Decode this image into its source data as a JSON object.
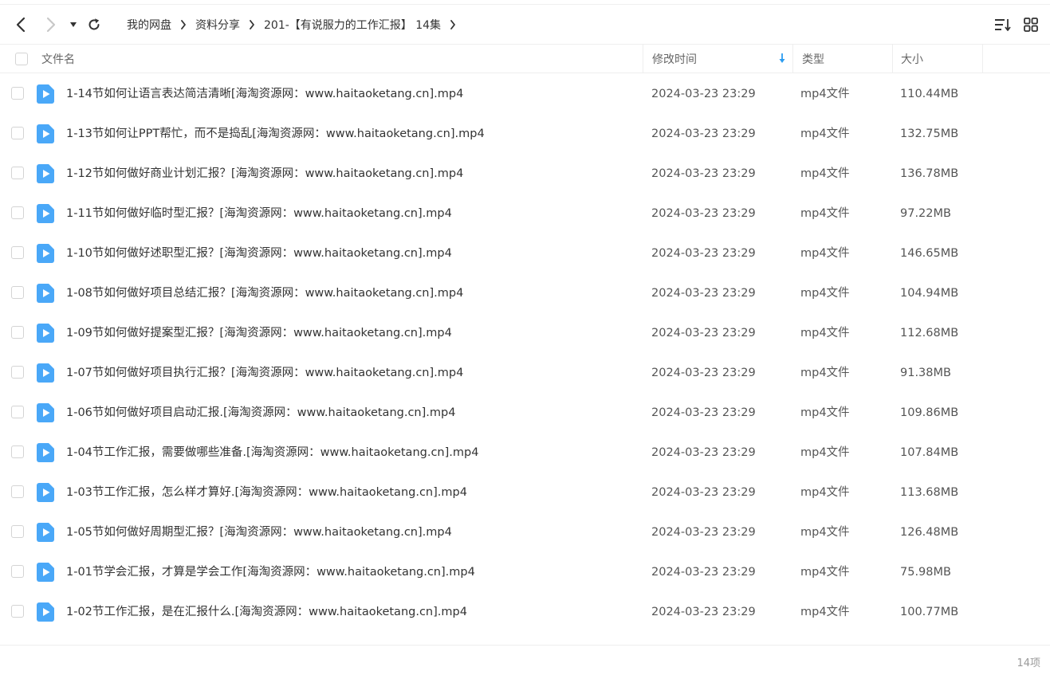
{
  "breadcrumb": [
    {
      "label": "我的网盘"
    },
    {
      "label": "资料分享"
    },
    {
      "label": "201-【有说服力的工作汇报】 14集"
    }
  ],
  "columns": {
    "name": "文件名",
    "time": "修改时间",
    "type": "类型",
    "size": "大小"
  },
  "files": [
    {
      "name": "1-14节如何让语言表达简洁清晰[海淘资源网：www.haitaoketang.cn].mp4",
      "time": "2024-03-23 23:29",
      "type": "mp4文件",
      "size": "110.44MB"
    },
    {
      "name": "1-13节如何让PPT帮忙，而不是捣乱[海淘资源网：www.haitaoketang.cn].mp4",
      "time": "2024-03-23 23:29",
      "type": "mp4文件",
      "size": "132.75MB"
    },
    {
      "name": "1-12节如何做好商业计划汇报？[海淘资源网：www.haitaoketang.cn].mp4",
      "time": "2024-03-23 23:29",
      "type": "mp4文件",
      "size": "136.78MB"
    },
    {
      "name": "1-11节如何做好临时型汇报？[海淘资源网：www.haitaoketang.cn].mp4",
      "time": "2024-03-23 23:29",
      "type": "mp4文件",
      "size": "97.22MB"
    },
    {
      "name": "1-10节如何做好述职型汇报？[海淘资源网：www.haitaoketang.cn].mp4",
      "time": "2024-03-23 23:29",
      "type": "mp4文件",
      "size": "146.65MB"
    },
    {
      "name": "1-08节如何做好项目总结汇报？[海淘资源网：www.haitaoketang.cn].mp4",
      "time": "2024-03-23 23:29",
      "type": "mp4文件",
      "size": "104.94MB"
    },
    {
      "name": "1-09节如何做好提案型汇报？[海淘资源网：www.haitaoketang.cn].mp4",
      "time": "2024-03-23 23:29",
      "type": "mp4文件",
      "size": "112.68MB"
    },
    {
      "name": "1-07节如何做好项目执行汇报？[海淘资源网：www.haitaoketang.cn].mp4",
      "time": "2024-03-23 23:29",
      "type": "mp4文件",
      "size": "91.38MB"
    },
    {
      "name": "1-06节如何做好项目启动汇报.[海淘资源网：www.haitaoketang.cn].mp4",
      "time": "2024-03-23 23:29",
      "type": "mp4文件",
      "size": "109.86MB"
    },
    {
      "name": "1-04节工作汇报，需要做哪些准备.[海淘资源网：www.haitaoketang.cn].mp4",
      "time": "2024-03-23 23:29",
      "type": "mp4文件",
      "size": "107.84MB"
    },
    {
      "name": "1-03节工作汇报，怎么样才算好.[海淘资源网：www.haitaoketang.cn].mp4",
      "time": "2024-03-23 23:29",
      "type": "mp4文件",
      "size": "113.68MB"
    },
    {
      "name": "1-05节如何做好周期型汇报？[海淘资源网：www.haitaoketang.cn].mp4",
      "time": "2024-03-23 23:29",
      "type": "mp4文件",
      "size": "126.48MB"
    },
    {
      "name": "1-01节学会汇报，才算是学会工作[海淘资源网：www.haitaoketang.cn].mp4",
      "time": "2024-03-23 23:29",
      "type": "mp4文件",
      "size": "75.98MB"
    },
    {
      "name": "1-02节工作汇报，是在汇报什么.[海淘资源网：www.haitaoketang.cn].mp4",
      "time": "2024-03-23 23:29",
      "type": "mp4文件",
      "size": "100.77MB"
    }
  ],
  "footer": {
    "count": "14项"
  },
  "icons": {
    "back": "chevron-left-icon",
    "forward": "chevron-right-icon",
    "history": "caret-down-icon",
    "refresh": "refresh-icon",
    "sort": "sort-list-icon",
    "grid": "grid-view-icon",
    "video": "video-file-icon"
  },
  "colors": {
    "accent": "#2c9cf0",
    "icon_blue": "#4aa8f8",
    "disabled": "#c8c8c8",
    "border": "#eeeeee"
  }
}
